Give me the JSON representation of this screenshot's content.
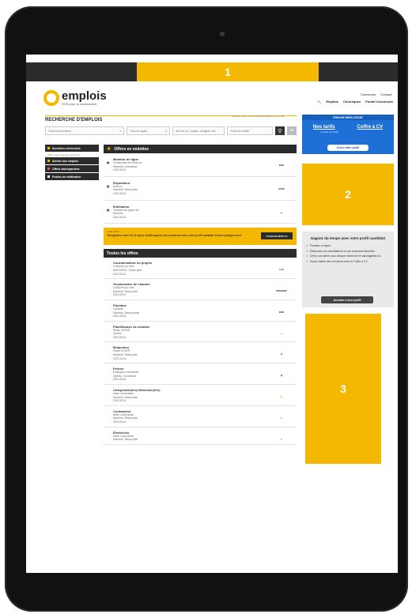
{
  "ads": {
    "top": "1",
    "right_top": "2",
    "right_bottom": "3"
  },
  "brand": {
    "name": "emplois",
    "tagline": "SOS pour la construction"
  },
  "top_links": {
    "login": "Connexion",
    "contact": "Contact"
  },
  "nav": {
    "search_icon": "search-icon",
    "items": [
      "Emplois",
      "Chroniques",
      "Portail Constructo"
    ]
  },
  "search": {
    "title": "RECHERCHE D'EMPLOIS",
    "hint": "Derniers mois pour 30 rapports aujourd'hui ce ville",
    "domain_placeholder": "Tous les domaines",
    "types_placeholder": "Tous les types",
    "keywords_placeholder": "Mot clé (ex. pigiste, designer de)",
    "location_placeholder": "Toute la localité"
  },
  "leftnav": [
    {
      "label": "Dernières recherches",
      "color": "#f5b800"
    },
    {
      "label": "Alertes aux emplois",
      "color": "#f5b800"
    },
    {
      "label": "Offres sauvegardées",
      "color": "#e8584d"
    },
    {
      "label": "Postes de notification",
      "color": "#ffffff"
    }
  ],
  "leftnav_note": "Vous n'avez aucune recherche",
  "featured": {
    "title": "Offres en vedettes",
    "jobs": [
      {
        "title": "Monteur de ligne",
        "company": "Construction en forme inc.",
        "location": "Montréal, Contractuel",
        "date": "2022-08-15",
        "logo": "ÉNÉ"
      },
      {
        "title": "Répartiteur",
        "company": "Nom inc.",
        "location": "Montréal, Temps plein",
        "date": "2022-08-15",
        "logo": "BOIS"
      },
      {
        "title": "Estimateur",
        "company": "Chateaux de papier inc.",
        "location": "Montréal",
        "date": "2022-08-15",
        "logo": "▲"
      }
    ]
  },
  "promo": {
    "small": "Votre profil",
    "text": "Enregistrez votre CV et soyez visible auprès des recruteurs avec votre profil candidat. Postez pratique ment",
    "button": "J'AJOUTE MON CV"
  },
  "all_offers": {
    "title": "Toutes les offres",
    "jobs": [
      {
        "title": "Coordonnateur de projets",
        "company": "La Bonde qui roule",
        "location": "MONTRÉAL, Temps plein",
        "date": "2022-08-15",
        "logo": "LBR"
      },
      {
        "title": "Gestionnaire de chantier",
        "company": "La Bonde qui roule",
        "location": "Montréal, Temps plein",
        "date": "2022-08-15",
        "logo": "PREMIER"
      },
      {
        "title": "Plombier",
        "company": "Canneau",
        "location": "Montréal, Temps partiel",
        "date": "2022-08-15",
        "logo": "ÉNÉ"
      },
      {
        "title": "Planificateur de chantier",
        "company": "Studio XCRER",
        "location": "Québec",
        "date": "2022-08-15",
        "logo": "▲"
      },
      {
        "title": "Briqueteur",
        "company": "Studio XCRER",
        "location": "Montréal, Temps plein",
        "date": "2022-08-15",
        "logo": "■"
      },
      {
        "title": "Peintre",
        "company": "Employeur confidentiel",
        "location": "Québec, Contractuel",
        "date": "2022-08-15",
        "logo": "◆"
      },
      {
        "title": "Charpentier(ère) Menuisier(ère)",
        "company": "Albar Construction",
        "location": "Montréal, Temps plein",
        "date": "2022-08-15",
        "logo": "★"
      },
      {
        "title": "Contracteur",
        "company": "Albar Construction",
        "location": "Montréal, Temps plein",
        "date": "2022-08-15",
        "logo": "★"
      },
      {
        "title": "Électricien",
        "company": "Albar Construction",
        "location": "Montréal, Temps plein",
        "date": "2022-08-15",
        "logo": "★"
      }
    ]
  },
  "employer": {
    "header": "ESPACE EMPLOYEUR",
    "link1": "Nos tarifs",
    "link2": "Coffre à CV",
    "sub1": "À partir de 2 695",
    "sub2": "",
    "button": "Créer votre profil"
  },
  "candidate": {
    "title": "Gagnez du temps avec votre profil candidat!",
    "items": [
      "Postulez en ligne.",
      "Retrouvez vos candidatures et vos annonces favorites.",
      "Créez une alerte pour chaque recherche et sauvegardez-la.",
      "Soyez visible des recruteurs avec le Coffre à CV."
    ],
    "button": "Accéder à mon profil"
  }
}
